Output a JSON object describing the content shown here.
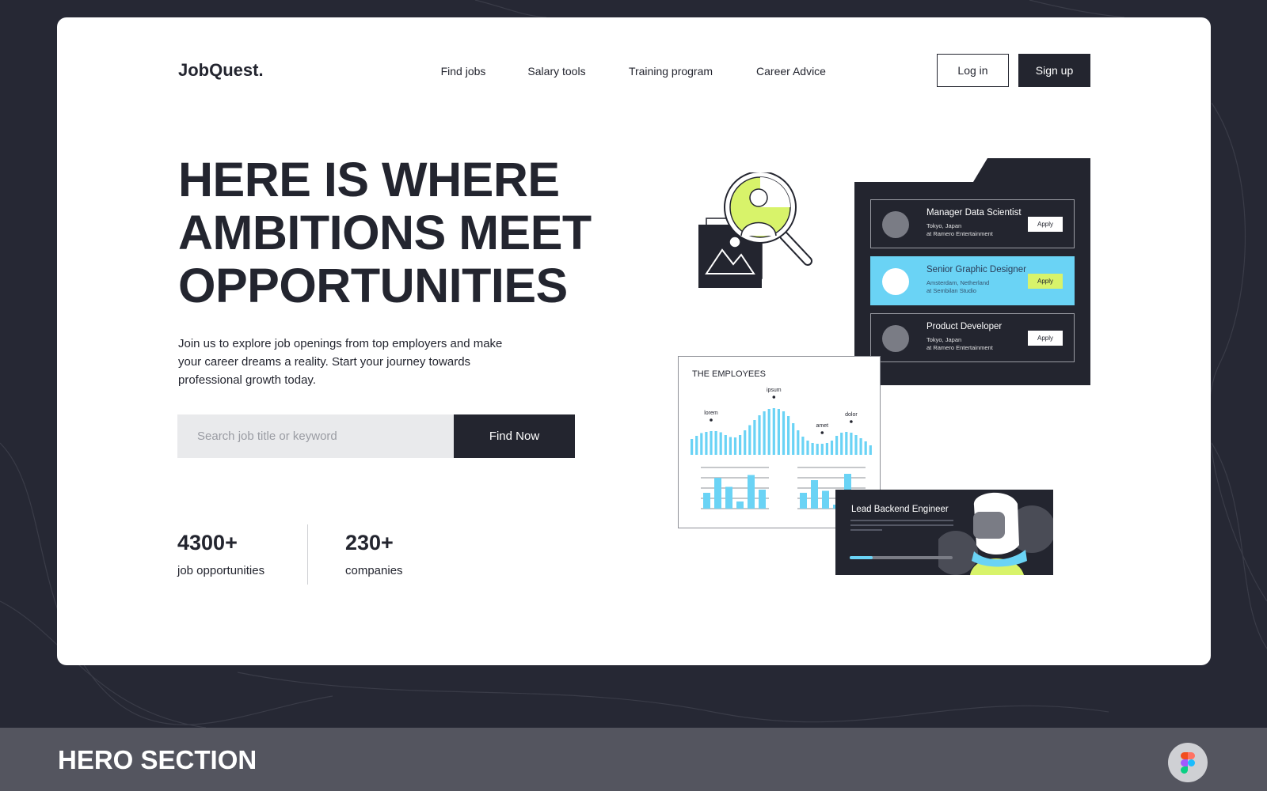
{
  "brand": "JobQuest.",
  "nav": [
    {
      "label": "Find jobs"
    },
    {
      "label": "Salary tools"
    },
    {
      "label": "Training program"
    },
    {
      "label": "Career Advice"
    }
  ],
  "auth": {
    "login": "Log in",
    "signup": "Sign up"
  },
  "hero": {
    "headline": [
      "HERE IS WHERE",
      "AMBITIONS MEET",
      "OPPORTUNITIES"
    ],
    "paragraph": "Join us to explore job openings from top employers and make your career dreams a reality. Start your journey towards professional growth today.",
    "search_placeholder": "Search job title or keyword",
    "search_value": "",
    "find_button": "Find Now"
  },
  "stats": [
    {
      "value": "4300+",
      "label": "job opportunities"
    },
    {
      "value": "230+",
      "label": "companies"
    }
  ],
  "jobs": [
    {
      "title": "Manager Data Scientist",
      "location": "Tokyo, Japan",
      "company": "at Ramero Entertainment",
      "apply": "Apply",
      "highlighted": false
    },
    {
      "title": "Senior Graphic Designer",
      "location": "Amsterdam, Netherland",
      "company": "at Sembilan Studio",
      "apply": "Apply",
      "highlighted": true
    },
    {
      "title": "Product Developer",
      "location": "Tokyo, Japan",
      "company": "at Ramero Entertainment",
      "apply": "Apply",
      "highlighted": false
    }
  ],
  "employees_card": {
    "title": "THE EMPLOYEES",
    "labels": [
      "lorem",
      "ipsum",
      "amet",
      "dolor"
    ],
    "wave": [
      40,
      48,
      55,
      58,
      60,
      60,
      57,
      50,
      45,
      44,
      50,
      62,
      75,
      88,
      100,
      110,
      116,
      118,
      116,
      110,
      98,
      80,
      62,
      46,
      36,
      30,
      28,
      28,
      30,
      36,
      48,
      56,
      58,
      56,
      50,
      42,
      34,
      24
    ],
    "bars_left": [
      40,
      78,
      55,
      18,
      85,
      48
    ],
    "bars_right": [
      40,
      72,
      45,
      10,
      88
    ]
  },
  "lead_card": {
    "title": "Lead Backend Engineer",
    "progress": 0.22
  },
  "footer": {
    "title": "HERO SECTION"
  },
  "colors": {
    "dark": "#23252f",
    "accent_blue": "#6ad3f5",
    "accent_lime": "#d8f36a",
    "background": "#262834",
    "footer": "#54555f"
  }
}
